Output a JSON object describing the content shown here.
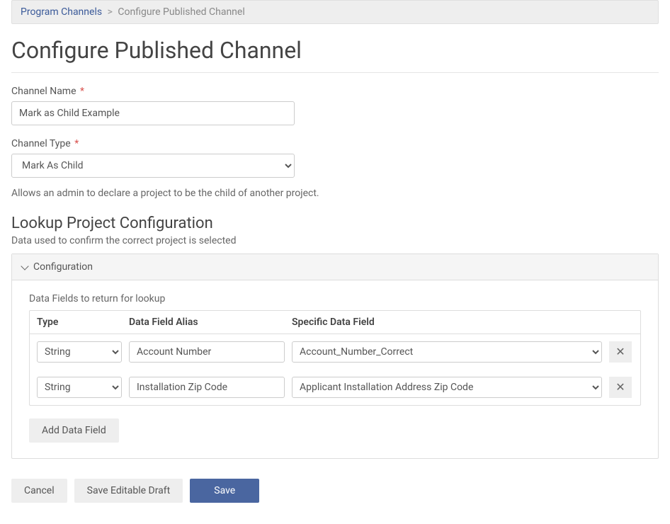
{
  "breadcrumb": {
    "parent": "Program Channels",
    "separator": ">",
    "current": "Configure Published Channel"
  },
  "page_title": "Configure Published Channel",
  "channel_name": {
    "label": "Channel Name",
    "required_marker": "*",
    "value": "Mark as Child Example"
  },
  "channel_type": {
    "label": "Channel Type",
    "required_marker": "*",
    "selected": "Mark As Child",
    "help": "Allows an admin to declare a project to be the child of another project."
  },
  "lookup_section": {
    "title": "Lookup Project Configuration",
    "description": "Data used to confirm the correct project is selected",
    "panel_title": "Configuration",
    "subsection_label": "Data Fields to return for lookup",
    "columns": {
      "type": "Type",
      "alias": "Data Field Alias",
      "specific": "Specific Data Field"
    },
    "rows": [
      {
        "type": "String",
        "alias": "Account Number",
        "specific": "Account_Number_Correct"
      },
      {
        "type": "String",
        "alias": "Installation Zip Code",
        "specific": "Applicant Installation Address Zip Code"
      }
    ],
    "add_button": "Add Data Field",
    "remove_icon_label": "remove"
  },
  "footer": {
    "cancel": "Cancel",
    "save_draft": "Save Editable Draft",
    "save": "Save"
  }
}
